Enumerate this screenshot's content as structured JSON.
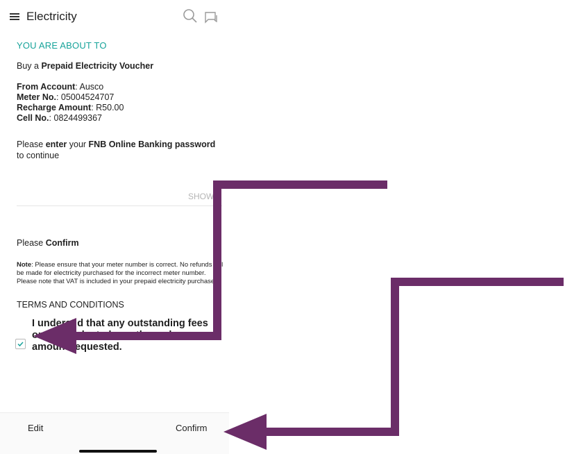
{
  "header": {
    "title": "Electricity"
  },
  "summary": {
    "heading": "YOU ARE ABOUT TO",
    "action_prefix": "Buy a ",
    "action_bold": "Prepaid Electricity Voucher",
    "from_label": "From Account",
    "from_value": ": Ausco",
    "meter_label": "Meter No.",
    "meter_value": ": 05004524707",
    "amount_label": "Recharge Amount",
    "amount_value": ": R50.00",
    "cell_label": "Cell No.",
    "cell_value": ": 0824499367"
  },
  "password": {
    "prompt_1": "Please ",
    "prompt_2": "enter",
    "prompt_3": " your ",
    "prompt_4": "FNB Online Banking password",
    "prompt_5": " to continue",
    "show_label": "SHOW"
  },
  "confirm_section": {
    "title_prefix": "Please ",
    "title_bold": "Confirm",
    "note_label": "Note",
    "note_text": ": Please ensure that your meter number is correct. No refunds will be made for electricity purchased for the incorrect meter number. Please note that VAT is included in your prepaid electricity purchase.",
    "terms_title": "TERMS AND CONDITIONS",
    "terms_text": "I underst      d that any outstanding fees or arre                                   deducted    rom the recharge amount requested.",
    "checked": true
  },
  "footer": {
    "edit_label": "Edit",
    "confirm_label": "Confirm"
  },
  "colors": {
    "accent": "#17a39a",
    "arrow": "#6b2d68"
  }
}
